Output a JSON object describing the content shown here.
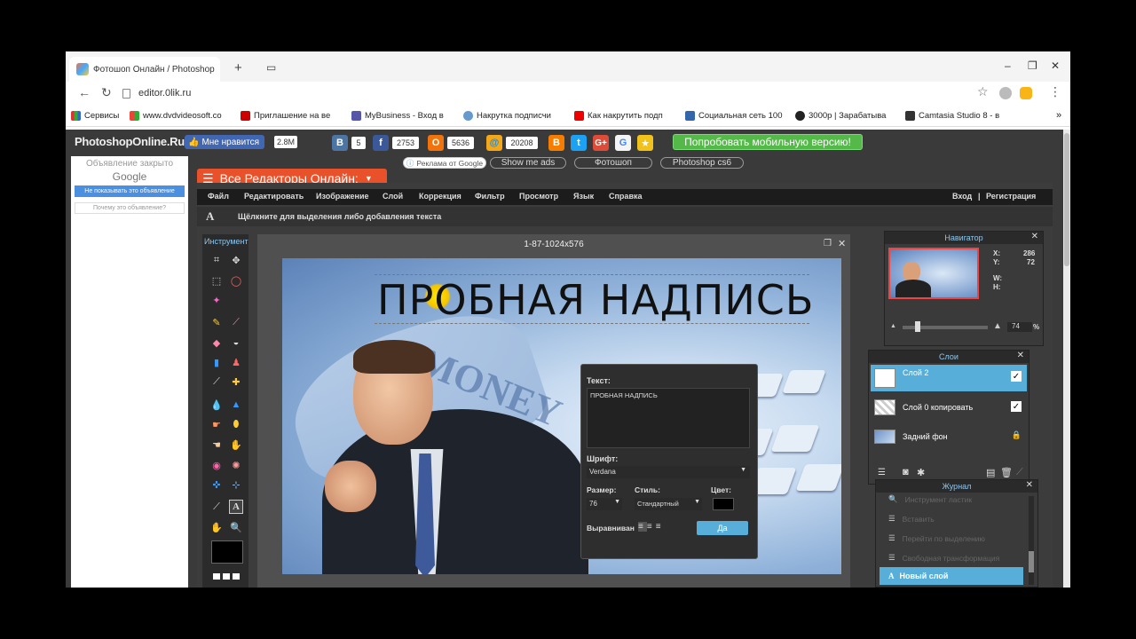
{
  "browser": {
    "tab_title": "Фотошоп Онлайн / Photoshop",
    "url": "editor.0lik.ru",
    "new_tab_symbol": "+",
    "minimize_symbol": "–",
    "maximize_symbol": "❐",
    "close_symbol": "✕",
    "bookmarks": [
      {
        "label": "Сервисы",
        "color": "#d33"
      },
      {
        "label": "www.dvdvideosoft.co",
        "color": "#e43"
      },
      {
        "label": "Приглашение на ве",
        "color": "#c00"
      },
      {
        "label": "MyBusiness - Вход в",
        "color": "#55a"
      },
      {
        "label": "Накрутка подписчи",
        "color": "#69c"
      },
      {
        "label": "Как накрутить подп",
        "color": "#e00"
      },
      {
        "label": "Социальная сеть 100",
        "color": "#36a"
      },
      {
        "label": "3000р | Зарабатыва",
        "color": "#222"
      },
      {
        "label": "Camtasia Studio 8 - в",
        "color": "#333"
      }
    ],
    "bookmarks_more": "»"
  },
  "site": {
    "logo": "PhotoshopOnline.Ru",
    "like_label": "Мне нравится",
    "like_count": "2.8M",
    "vk_letter": "B",
    "vk_count": "5",
    "fb_letter": "f",
    "fb_count": "2753",
    "ok_letter": "О",
    "ok_count": "5636",
    "mail_letter": "@",
    "mail_count": "20208",
    "mobile_button": "Попробовать мобильную версию!",
    "ad_by_google": "Реклама от Google",
    "show_me_ads": "Show me ads",
    "link_photoshop": "Фотошоп",
    "link_cs6": "Photoshop cs6",
    "all_editors": "Все Редакторы Онлайн:",
    "ad_closed": "Объявление закрыто",
    "ad_google": "Google",
    "ad_dont_show": "Не показывать это объявление",
    "ad_why": "Почему это объявление?"
  },
  "editor": {
    "menu": [
      "Файл",
      "Редактировать",
      "Изображение",
      "Слой",
      "Коррекция",
      "Фильтр",
      "Просмотр",
      "Язык",
      "Справка"
    ],
    "login": "Вход",
    "register": "Регистрация",
    "separator": "|",
    "hint": "Щёлкните для выделения либо добавления текста",
    "text_tool_letter": "A",
    "tools_title": "Инструмент",
    "document_title": "1-87-1024x576",
    "canvas_text": "ПРОБНАЯ НАДПИСЬ",
    "dialog": {
      "text_label": "Текст:",
      "text_value": "ПРОБНАЯ НАДПИСЬ",
      "font_label": "Шрифт:",
      "font_value": "Verdana",
      "size_label": "Размер:",
      "size_value": "76",
      "style_label": "Стиль:",
      "style_value": "Стандартный",
      "color_label": "Цвет:",
      "color_value": "#000000",
      "align_label": "Выравниван",
      "ok_button": "Да"
    },
    "navigator": {
      "title": "Навигатор",
      "x_label": "X:",
      "x_value": "286",
      "y_label": "Y:",
      "y_value": "72",
      "w_label": "W:",
      "h_label": "H:",
      "zoom": "74",
      "zoom_unit": "%"
    },
    "layers": {
      "title": "Слои",
      "items": [
        {
          "name": "Слой 2",
          "check": "✓"
        },
        {
          "name": "Слой 0 копировать",
          "check": "✓"
        },
        {
          "name": "Задний фон",
          "check": "🔒"
        }
      ]
    },
    "history": {
      "title": "Журнал",
      "items": [
        "Инструмент ластик",
        "Вставить",
        "Перейти по выделению",
        "Свободная трансформация",
        "Новый слой"
      ]
    }
  }
}
